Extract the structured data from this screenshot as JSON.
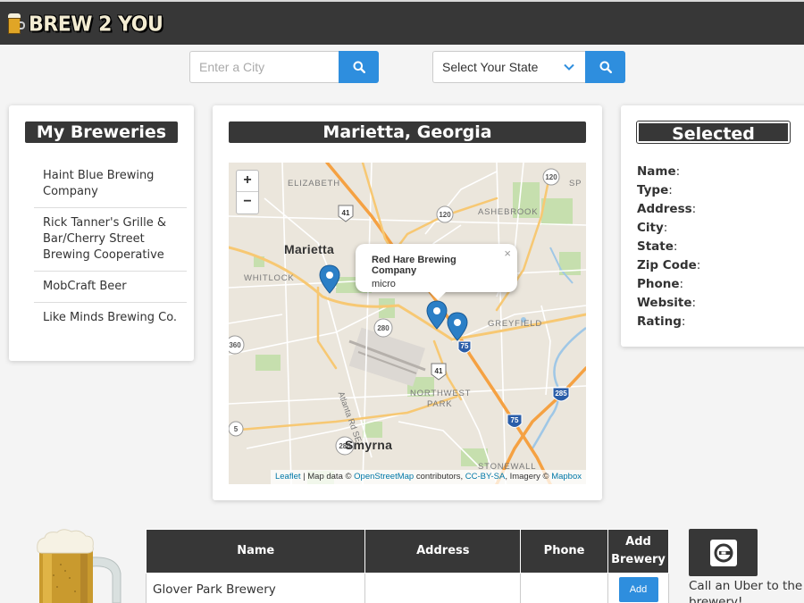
{
  "header": {
    "logo_text": "BREW 2 YOU"
  },
  "search": {
    "city_placeholder": "Enter a City",
    "state_selected": "Select Your State"
  },
  "my_breweries": {
    "title": "My Breweries",
    "items": [
      "Haint Blue Brewing Company",
      "Rick Tanner's Grille & Bar/Cherry Street Brewing Cooperative",
      "MobCraft Beer",
      "Like Minds Brewing Co."
    ]
  },
  "map_card": {
    "title": "Marietta, Georgia",
    "zoom_in": "+",
    "zoom_out": "−",
    "popup": {
      "name": "Red Hare Brewing Company",
      "type": "micro",
      "close": "×"
    },
    "labels": {
      "elizabeth": "ELIZABETH",
      "ashebrook": "ASHEBROOK",
      "marietta": "Marietta",
      "whitlock": "WHITLOCK",
      "greyfield": "GREYFIELD",
      "northwest_park": "NORTHWEST",
      "northwest_park2": "PARK",
      "smyrna": "Smyrna",
      "stonewall": "STONEWALL",
      "atlanta_rd": "Atlanta Rd SE",
      "sp": "SP"
    },
    "shields": {
      "r120a": "120",
      "r120b": "120",
      "r41a": "41",
      "r41b": "41",
      "r280a": "280",
      "r280b": "280",
      "r360": "360",
      "r5": "5",
      "r285": "285",
      "r75": "75",
      "r75b": "75"
    },
    "attribution": {
      "leaflet": "Leaflet",
      "sep1": " | Map data © ",
      "osm": "OpenStreetMap",
      "contrib": " contributors, ",
      "ccbysa": "CC-BY-SA",
      "imagery": ", Imagery © ",
      "mapbox": "Mapbox"
    },
    "colors": {
      "road_major": "#f5a142",
      "water": "#9fc7e6",
      "park": "#c6dfae",
      "marker": "#2b7fc6"
    }
  },
  "selected_brewery": {
    "title": "Selected Brewery",
    "fields": [
      "Name",
      "Type",
      "Address",
      "City",
      "State",
      "Zip Code",
      "Phone",
      "Website",
      "Rating"
    ]
  },
  "results": {
    "headers": {
      "name": "Name",
      "address": "Address",
      "phone": "Phone",
      "add": "Add Brewery"
    },
    "rows": [
      {
        "name": "Glover Park Brewery",
        "address": "",
        "phone": "",
        "add_label": "Add"
      }
    ]
  },
  "uber": {
    "text": "Call an Uber to the",
    "text2": "brewery!"
  }
}
